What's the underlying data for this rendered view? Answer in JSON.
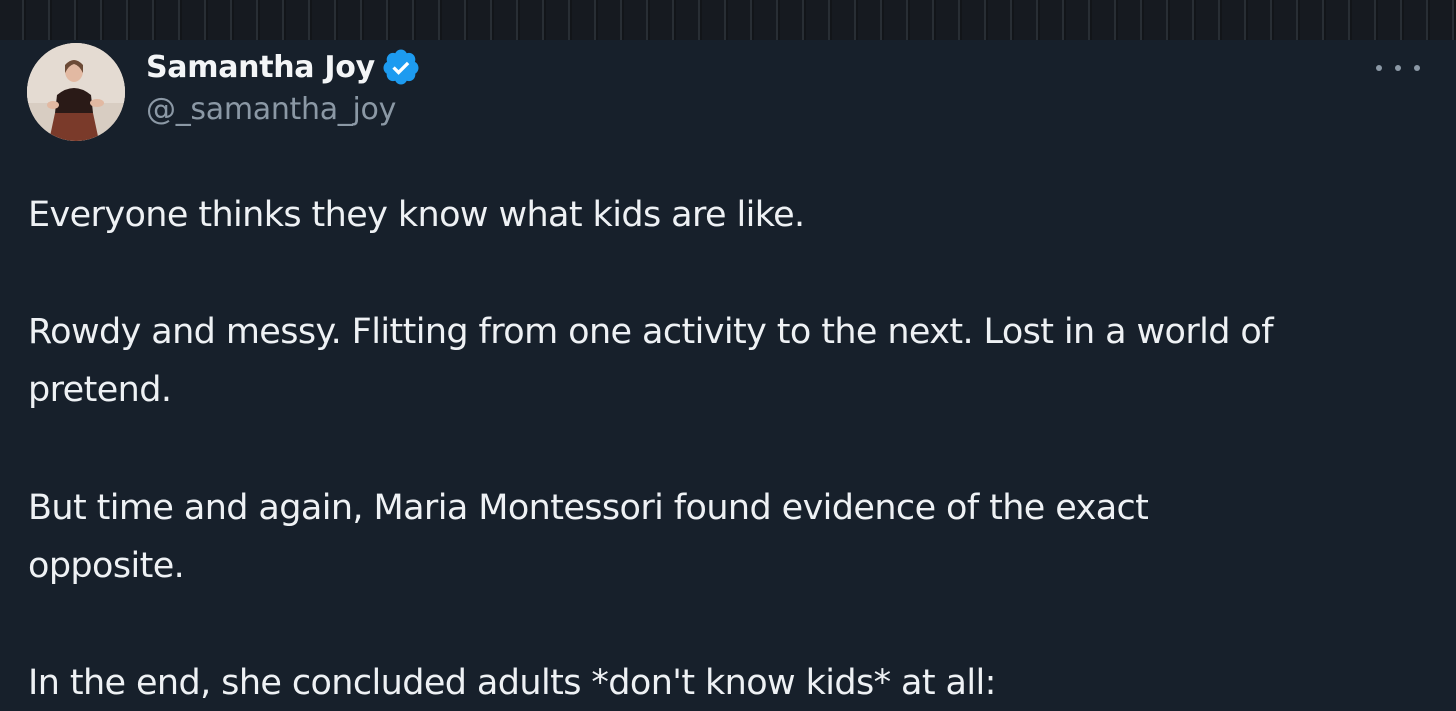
{
  "author": {
    "display_name": "Samantha Joy",
    "handle": "@_samantha_joy",
    "verified": true,
    "verified_color": "#1d9bf0"
  },
  "icons": {
    "avatar": "profile-photo-avatar",
    "verified": "verified-badge-icon",
    "more": "more-options-icon"
  },
  "tweet": {
    "paragraphs": [
      {
        "lines": [
          "Everyone thinks they know what kids are like."
        ]
      },
      {
        "lines": [
          "Rowdy and messy. Flitting from one activity to the next. Lost in a world of",
          "pretend."
        ]
      },
      {
        "lines": [
          "But time and again, Maria Montessori found evidence of the exact",
          "opposite."
        ]
      },
      {
        "lines": [
          "In the end, she concluded adults *don't know kids* at all:"
        ]
      }
    ]
  },
  "colors": {
    "background": "#17202b",
    "text": "#eef1f4",
    "secondary_text": "#8b98a5",
    "accent": "#1d9bf0"
  }
}
